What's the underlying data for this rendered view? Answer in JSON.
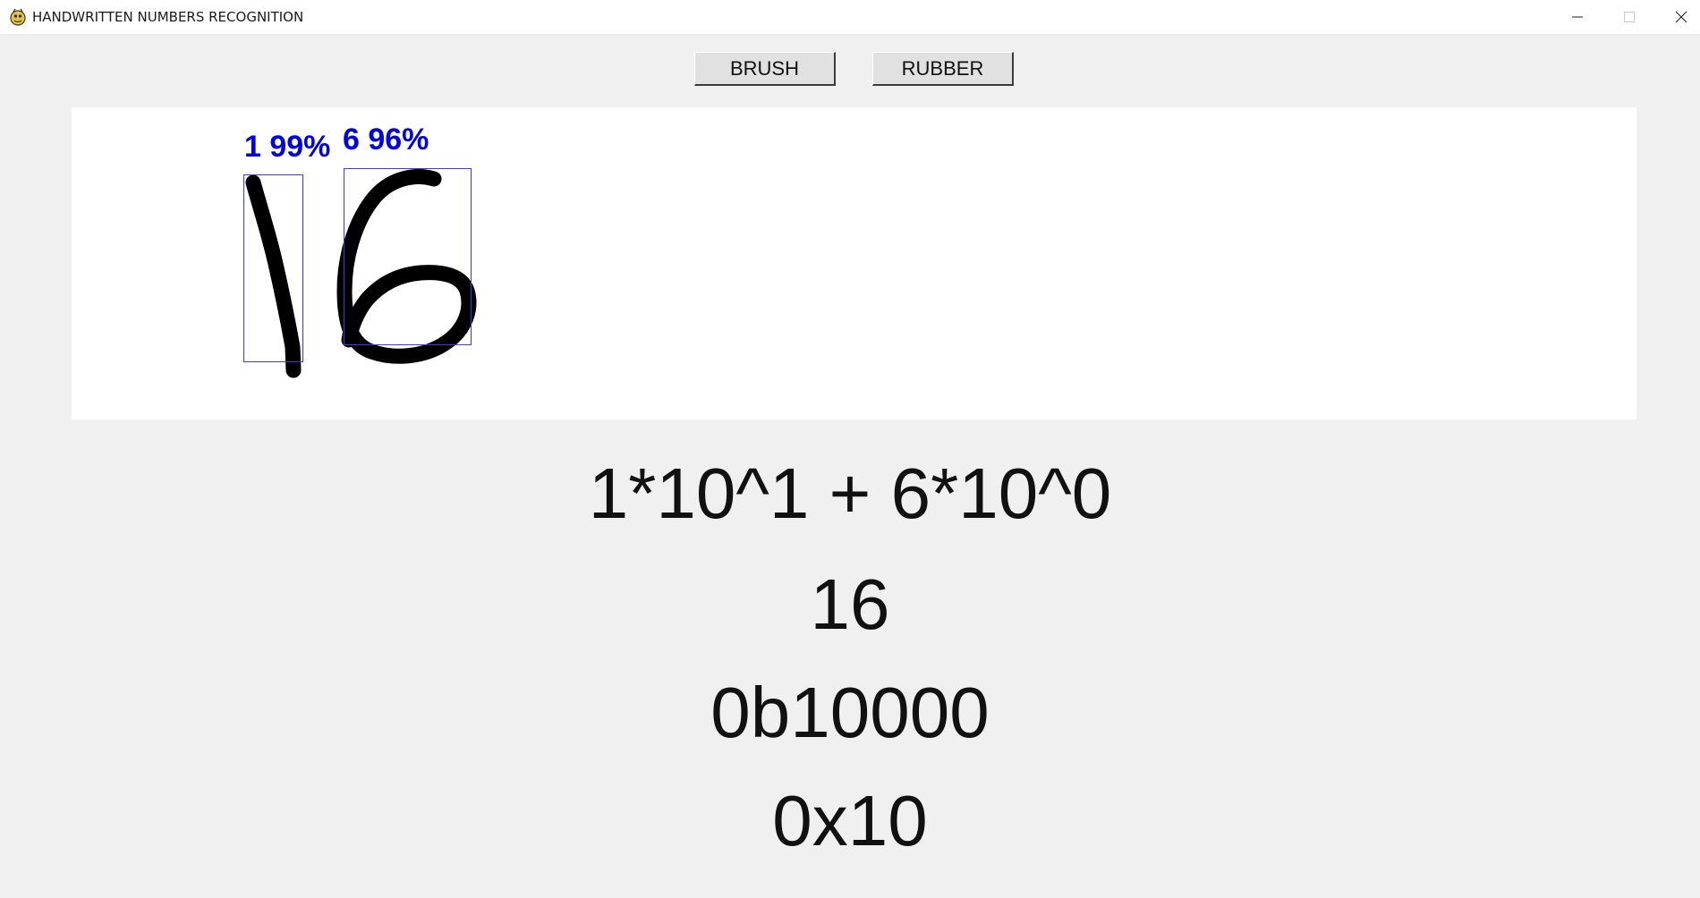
{
  "window": {
    "title": "HANDWRITTEN NUMBERS RECOGNITION",
    "icon": "pygame-snake-icon",
    "controls": [
      "minimize-icon",
      "maximize-icon",
      "close-icon"
    ]
  },
  "toolbar": {
    "brush_label": "BRUSH",
    "rubber_label": "RUBBER"
  },
  "canvas": {
    "predictions": [
      {
        "digit": "1",
        "confidence": "99%",
        "label": "1 99%"
      },
      {
        "digit": "6",
        "confidence": "96%",
        "label": "6 96%"
      }
    ],
    "bbox_color": "#3a3ae8",
    "label_color": "#0000e6",
    "stroke_color": "#000000"
  },
  "results": {
    "expansion": "1*10^1 + 6*10^0",
    "decimal": "16",
    "binary": "0b10000",
    "hex": "0x10"
  }
}
